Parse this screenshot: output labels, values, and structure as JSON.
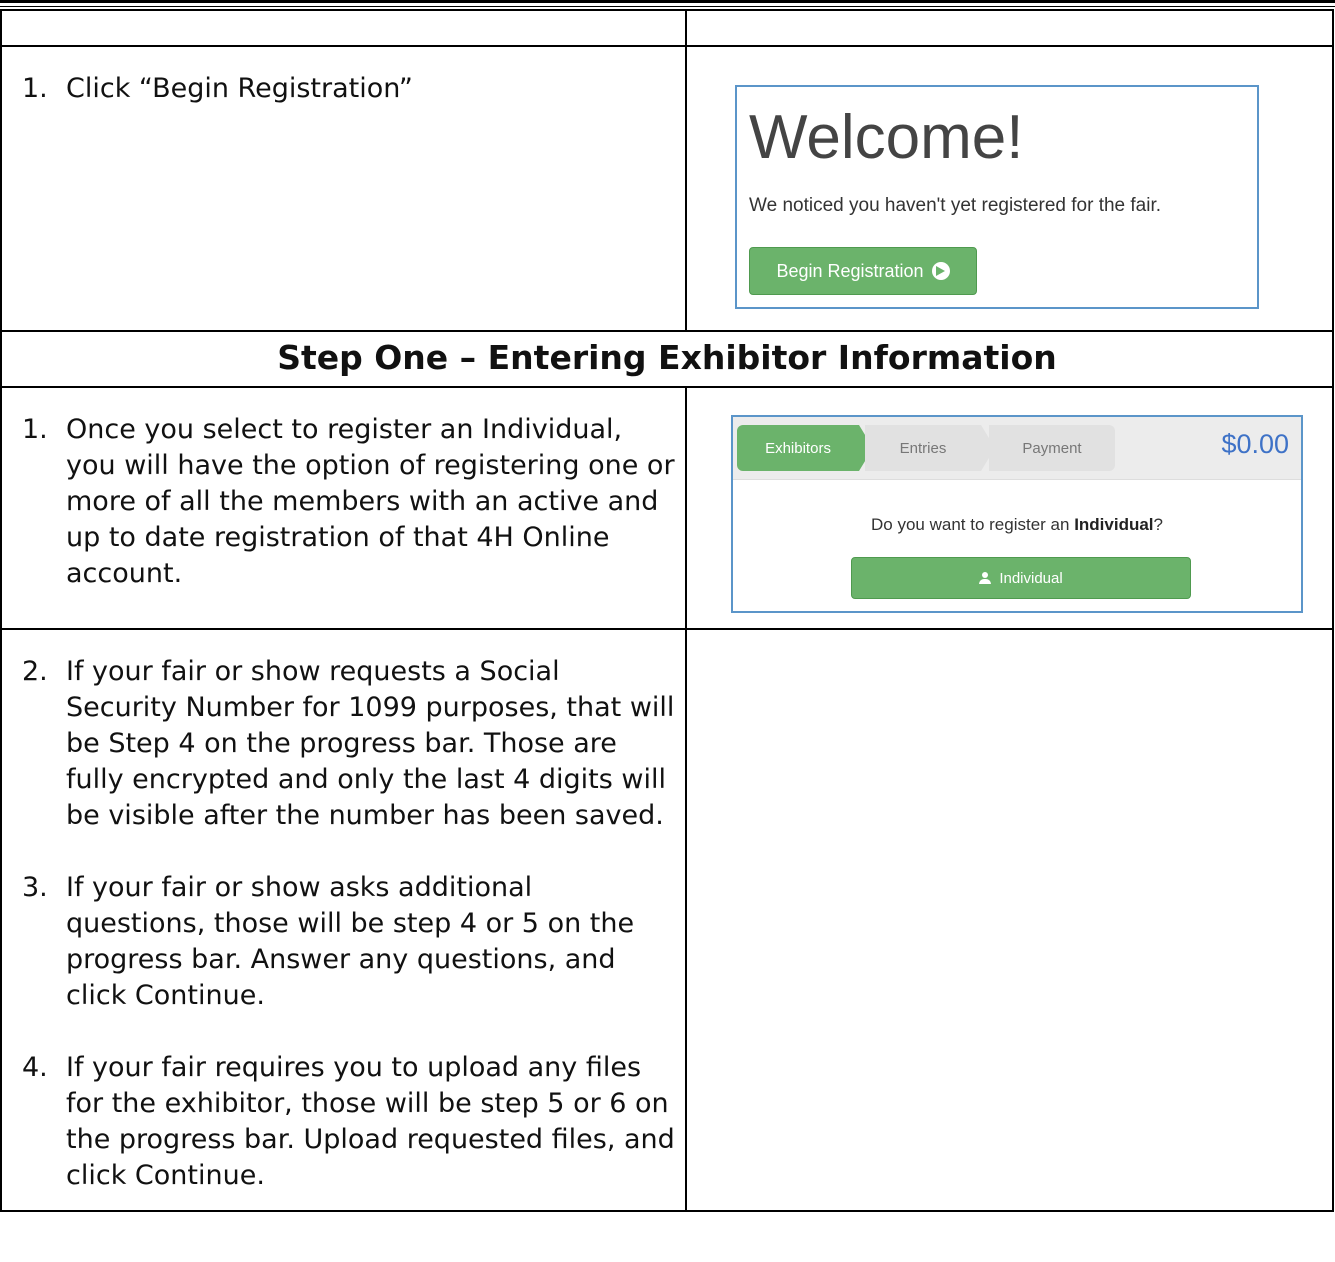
{
  "row1": {
    "step1": {
      "num": "1.",
      "text": "Click “Begin Registration”"
    },
    "welcome": {
      "title": "Welcome!",
      "subtitle": "We noticed you haven't yet registered for the fair.",
      "button_label": "Begin Registration"
    }
  },
  "section_heading": "Step One – Entering Exhibitor Information",
  "row2": {
    "step1": {
      "num": "1.",
      "text": "Once you select to register an Individual, you will have the option of registering one or more of all the members with an active and up to date registration of that 4H Online account."
    },
    "panel": {
      "crumbs": [
        "Exhibitors",
        "Entries",
        "Payment"
      ],
      "total": "$0.00",
      "question_prefix": "Do you want to register an ",
      "question_bold": "Individual",
      "question_suffix": "?",
      "button_label": "Individual"
    }
  },
  "row3": {
    "steps": [
      {
        "num": "2.",
        "text": "If your fair or show requests a Social Security Number for 1099 purposes, that will be Step 4 on the progress bar. Those are fully encrypted and only the last 4 digits will be visible after the number has been saved."
      },
      {
        "num": "3.",
        "text": "If your fair or show asks additional questions, those will be step 4 or 5 on the progress bar. Answer any questions, and click Continue."
      },
      {
        "num": "4.",
        "text": "If your fair requires you to upload any files for the exhibitor, those will be step 5 or 6 on the progress bar. Upload requested files, and click Continue."
      }
    ]
  },
  "colors": {
    "accent_green": "#6bb36b",
    "panel_border": "#5b95c9",
    "total_blue": "#3e72c7"
  }
}
